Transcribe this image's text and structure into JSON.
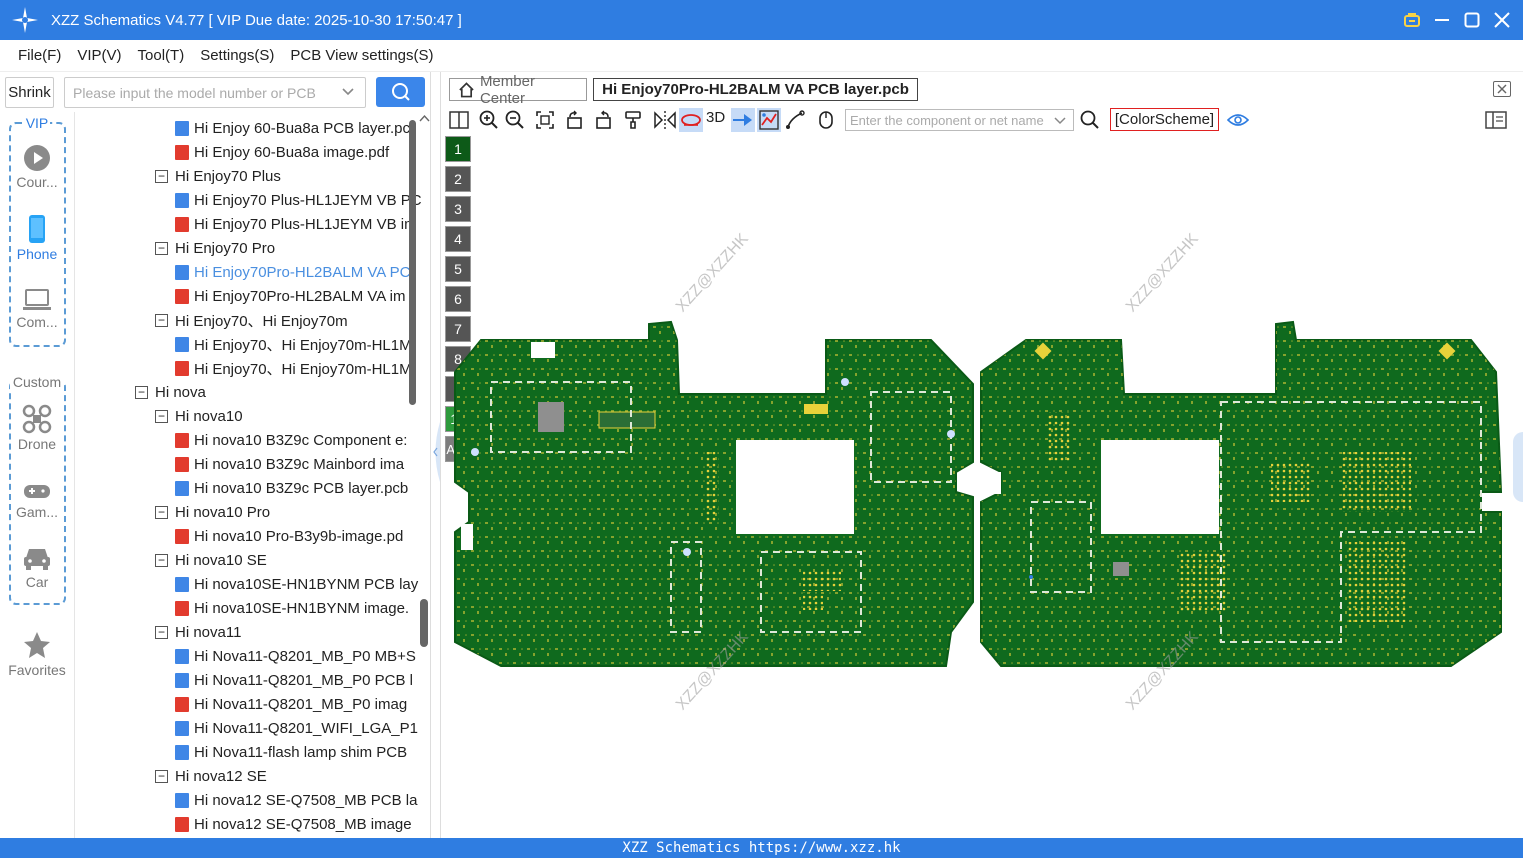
{
  "window": {
    "title": "XZZ Schematics V4.77 [ VIP Due date: 2025-10-30 17:50:47 ]",
    "logo_icon": "star-compass-icon",
    "controls": [
      "shirt-icon",
      "minimize-icon",
      "maximize-icon",
      "close-icon"
    ]
  },
  "menu": {
    "items": [
      "File(F)",
      "VIP(V)",
      "Tool(T)",
      "Settings(S)",
      "PCB View settings(S)"
    ]
  },
  "search": {
    "shrink_label": "Shrink",
    "placeholder": "Please input the model number or PCB",
    "button_icon": "search-icon"
  },
  "rail": {
    "vip_label": "VIP",
    "vip_items": [
      {
        "label": "Cour...",
        "icon": "play-circle-icon"
      },
      {
        "label": "Phone",
        "icon": "phone-icon"
      },
      {
        "label": "Com...",
        "icon": "laptop-icon"
      }
    ],
    "custom_label": "Custom",
    "custom_items": [
      {
        "label": "Drone",
        "icon": "drone-icon"
      },
      {
        "label": "Gam...",
        "icon": "gamepad-icon"
      },
      {
        "label": "Car",
        "icon": "car-icon"
      }
    ],
    "favorites_label": "Favorites"
  },
  "tree": {
    "rows": [
      {
        "type": "pcb",
        "level": 2,
        "label": "Hi Enjoy 60-Bua8a PCB layer.pc"
      },
      {
        "type": "pdf",
        "level": 2,
        "label": "Hi Enjoy 60-Bua8a image.pdf"
      },
      {
        "type": "folder",
        "level": 1,
        "label": "Hi Enjoy70 Plus"
      },
      {
        "type": "pcb",
        "level": 2,
        "label": "Hi Enjoy70 Plus-HL1JEYM VB PC"
      },
      {
        "type": "pdf",
        "level": 2,
        "label": "Hi Enjoy70 Plus-HL1JEYM VB im"
      },
      {
        "type": "folder",
        "level": 1,
        "label": "Hi Enjoy70 Pro"
      },
      {
        "type": "pcb",
        "level": 2,
        "label": "Hi Enjoy70Pro-HL2BALM VA PC",
        "selected": true
      },
      {
        "type": "pdf",
        "level": 2,
        "label": "Hi Enjoy70Pro-HL2BALM VA im"
      },
      {
        "type": "folder",
        "level": 1,
        "label": "Hi Enjoy70、Hi Enjoy70m"
      },
      {
        "type": "pcb",
        "level": 2,
        "label": "Hi Enjoy70、Hi Enjoy70m-HL1M"
      },
      {
        "type": "pdf",
        "level": 2,
        "label": "Hi Enjoy70、Hi Enjoy70m-HL1M"
      },
      {
        "type": "folder",
        "level": 0,
        "label": "Hi nova"
      },
      {
        "type": "folder",
        "level": 1,
        "label": "Hi nova10"
      },
      {
        "type": "pdf",
        "level": 2,
        "label": "Hi nova10 B3Z9c Component e:"
      },
      {
        "type": "pdf",
        "level": 2,
        "label": "Hi nova10 B3Z9c Mainbord ima"
      },
      {
        "type": "pcb",
        "level": 2,
        "label": "Hi nova10 B3Z9c PCB layer.pcb"
      },
      {
        "type": "folder",
        "level": 1,
        "label": "Hi nova10 Pro"
      },
      {
        "type": "pdf",
        "level": 2,
        "label": "Hi nova10 Pro-B3y9b-image.pd"
      },
      {
        "type": "folder",
        "level": 1,
        "label": "Hi nova10 SE"
      },
      {
        "type": "pcb",
        "level": 2,
        "label": "Hi nova10SE-HN1BYNM PCB lay"
      },
      {
        "type": "pdf",
        "level": 2,
        "label": "Hi nova10SE-HN1BYNM image."
      },
      {
        "type": "folder",
        "level": 1,
        "label": "Hi nova11"
      },
      {
        "type": "pcb",
        "level": 2,
        "label": "Hi Nova11-Q8201_MB_P0 MB+S"
      },
      {
        "type": "pcb",
        "level": 2,
        "label": "Hi Nova11-Q8201_MB_P0 PCB l"
      },
      {
        "type": "pdf",
        "level": 2,
        "label": "Hi Nova11-Q8201_MB_P0 imag"
      },
      {
        "type": "pcb",
        "level": 2,
        "label": "Hi Nova11-Q8201_WIFI_LGA_P1"
      },
      {
        "type": "pcb",
        "level": 2,
        "label": "Hi Nova11-flash lamp shim PCB"
      },
      {
        "type": "folder",
        "level": 1,
        "label": "Hi nova12 SE"
      },
      {
        "type": "pcb",
        "level": 2,
        "label": "Hi nova12 SE-Q7508_MB PCB la"
      },
      {
        "type": "pdf",
        "level": 2,
        "label": "Hi nova12 SE-Q7508_MB image"
      }
    ]
  },
  "tabs": {
    "member_label": "Member Center",
    "active_label": "Hi Enjoy70Pro-HL2BALM VA PCB layer.pcb"
  },
  "toolbar": {
    "three_d": "3D",
    "component_placeholder": "Enter the component or net name",
    "color_scheme": "[ColorScheme]"
  },
  "layers": [
    "1",
    "2",
    "3",
    "4",
    "5",
    "6",
    "7",
    "8",
    "9",
    "10",
    "ALL"
  ],
  "watermark": "XZZ@XZZHK",
  "status": "XZZ Schematics https://www.xzz.hk",
  "colors": {
    "accent": "#2f7de1",
    "board_green": "#0f6a1e",
    "pad_yellow": "#e8d23a",
    "color_scheme_border": "#e02020"
  }
}
